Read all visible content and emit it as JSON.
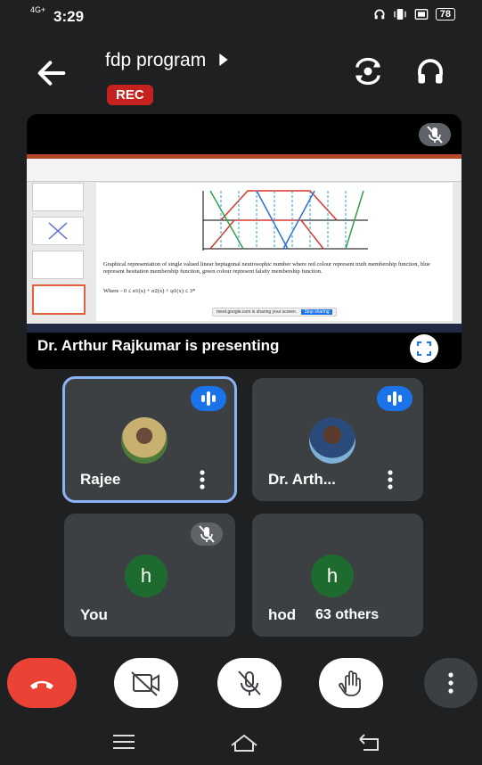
{
  "status_bar": {
    "network": "4G+",
    "time": "3:29",
    "battery": "78"
  },
  "header": {
    "title": "fdp program",
    "rec_label": "REC"
  },
  "presentation": {
    "caption": "Dr. Arthur Rajkumar is presenting",
    "slide_text": "Graphical representation of single valued linear heptagonal neutrosophic number where red colour represent truth membership function, blue represent hesitation membership function, green colour represent falsity membership function.",
    "slide_formula": "Where - 0 ≤ σ1(x) + σ2(x) + φ1(x) ≤ 3*",
    "share_banner": "meet.google.com is sharing your screen.",
    "stop_sharing": "Stop sharing"
  },
  "participants": [
    {
      "name": "Rajee",
      "state": "speaking",
      "avatar": "photo"
    },
    {
      "name": "Dr. Arth...",
      "state": "speaking",
      "avatar": "photo"
    },
    {
      "name": "You",
      "state": "muted",
      "avatar_letter": "h"
    },
    {
      "name": "hod",
      "state": "none",
      "avatar_letter": "h"
    }
  ],
  "others_label": "63 others",
  "colors": {
    "background": "#1f2022",
    "tile": "#3c4043",
    "rec": "#c5221f",
    "end_call": "#ea4335",
    "speaking": "#1a73e8",
    "active_outline": "#8ab4f8",
    "avatar_green": "#1e6b2f"
  },
  "icons": {
    "back": "arrow-left-icon",
    "switch_camera": "switch-camera-icon",
    "audio": "headphones-icon",
    "end_call": "phone-hangup-icon",
    "camera": "video-off-icon",
    "mic": "mic-off-icon",
    "hand": "raise-hand-icon",
    "more": "more-vertical-icon"
  }
}
